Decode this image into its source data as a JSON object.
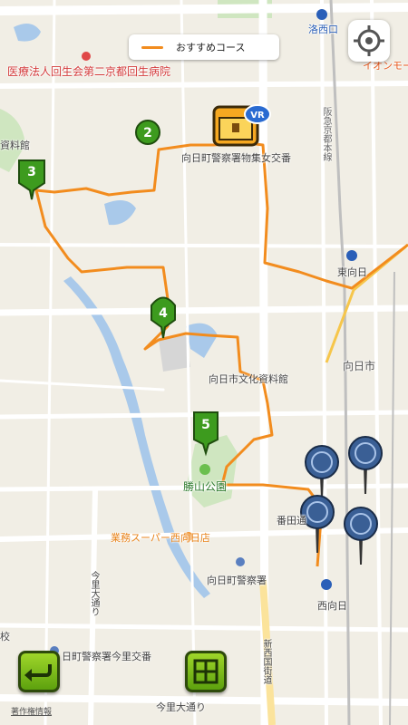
{
  "legend": {
    "label": "おすすめコース",
    "line_color": "#f28c1e"
  },
  "labels": {
    "hospital": "医療法人回生会第二京都回生病院",
    "station_rakusai": "洛西口",
    "aeon": "イオンモー",
    "shiryokan_left": "資料館",
    "police_box_mukomachi": "向日町警察署物集女交番",
    "railway": "阪急京都本線",
    "station_higashimuko": "東向日",
    "mukoshi": "向日市",
    "bunka_shiryokan": "向日市文化資料館",
    "katsuyama_park": "勝山公園",
    "gyomu_super": "業務スーパー西向日店",
    "bandori": "番田通",
    "police_mukomachi": "向日町警察署",
    "station_nishimuko": "西向日",
    "imazato_odori_v": "今里大通り",
    "imazato_police_box": "日町警察署今里交番",
    "imazato_odori_h": "今里大通り",
    "shinsaikoku": "新西国街道",
    "school": "校"
  },
  "markers": [
    "2",
    "3",
    "4",
    "5"
  ],
  "special_marker": {
    "badge": "VR",
    "icon": "treasure-chest-icon"
  },
  "pins_count": 4,
  "buttons": {
    "locate": "locate-crosshair-icon",
    "back": "return-arrow-icon",
    "map_toggle": "map-grid-icon"
  },
  "copyright": "著作権情報"
}
